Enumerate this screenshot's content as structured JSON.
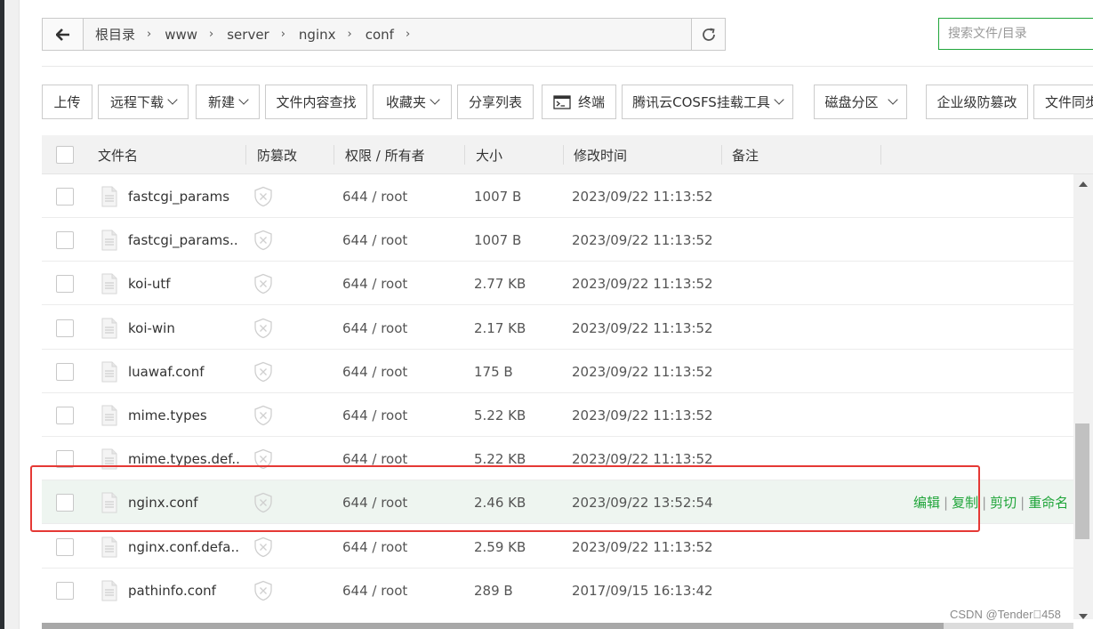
{
  "breadcrumb": [
    "根目录",
    "www",
    "server",
    "nginx",
    "conf"
  ],
  "search": {
    "placeholder": "搜索文件/目录"
  },
  "toolbar": [
    {
      "label": "上传",
      "dropdown": false
    },
    {
      "label": "远程下载",
      "dropdown": true
    },
    {
      "label": "新建",
      "dropdown": true
    },
    {
      "label": "文件内容查找",
      "dropdown": false
    },
    {
      "label": "收藏夹",
      "dropdown": true
    },
    {
      "label": "分享列表",
      "dropdown": false
    },
    {
      "label": "终端",
      "dropdown": false,
      "icon": "terminal-icon"
    },
    {
      "label": "腾讯云COSFS挂载工具",
      "dropdown": true
    },
    {
      "label": "磁盘分区",
      "dropdown": true
    },
    {
      "label": "企业级防篡改",
      "dropdown": false
    },
    {
      "label": "文件同步",
      "dropdown": false
    }
  ],
  "table": {
    "columns": [
      "文件名",
      "防篡改",
      "权限 / 所有者",
      "大小",
      "修改时间",
      "备注"
    ],
    "rows": [
      {
        "name": "fastcgi_params",
        "perm": "644 / root",
        "size": "1007 B",
        "mtime": "2023/09/22 11:13:52",
        "highlighted": false
      },
      {
        "name": "fastcgi_params....",
        "perm": "644 / root",
        "size": "1007 B",
        "mtime": "2023/09/22 11:13:52",
        "highlighted": false
      },
      {
        "name": "koi-utf",
        "perm": "644 / root",
        "size": "2.77 KB",
        "mtime": "2023/09/22 11:13:52",
        "highlighted": false
      },
      {
        "name": "koi-win",
        "perm": "644 / root",
        "size": "2.17 KB",
        "mtime": "2023/09/22 11:13:52",
        "highlighted": false
      },
      {
        "name": "luawaf.conf",
        "perm": "644 / root",
        "size": "175 B",
        "mtime": "2023/09/22 11:13:52",
        "highlighted": false
      },
      {
        "name": "mime.types",
        "perm": "644 / root",
        "size": "5.22 KB",
        "mtime": "2023/09/22 11:13:52",
        "highlighted": false
      },
      {
        "name": "mime.types.def...",
        "perm": "644 / root",
        "size": "5.22 KB",
        "mtime": "2023/09/22 11:13:52",
        "highlighted": false
      },
      {
        "name": "nginx.conf",
        "perm": "644 / root",
        "size": "2.46 KB",
        "mtime": "2023/09/22 13:52:54",
        "highlighted": true
      },
      {
        "name": "nginx.conf.defa...",
        "perm": "644 / root",
        "size": "2.59 KB",
        "mtime": "2023/09/22 11:13:52",
        "highlighted": false
      },
      {
        "name": "pathinfo.conf",
        "perm": "644 / root",
        "size": "289 B",
        "mtime": "2017/09/15 16:13:42",
        "highlighted": false
      }
    ],
    "row_actions": [
      "编辑",
      "复制",
      "剪切",
      "重命名"
    ]
  },
  "watermark": "CSDN @Tender\u0000458",
  "colors": {
    "accent": "#20a53a",
    "highlight_border": "#e53935",
    "row_highlight": "#eef5f0"
  }
}
